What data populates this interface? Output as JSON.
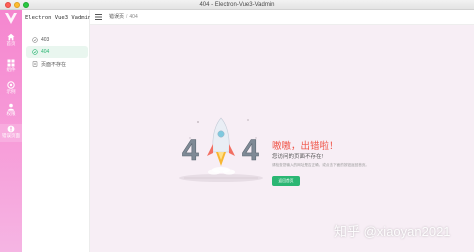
{
  "window": {
    "title": "404 - Electron-Vue3-Vadmin"
  },
  "rail": {
    "items": [
      {
        "label": "首页",
        "icon": "home-icon"
      },
      {
        "label": "组件",
        "icon": "grid-icon"
      },
      {
        "label": "示例",
        "icon": "sample-icon"
      },
      {
        "label": "权限",
        "icon": "user-icon"
      },
      {
        "label": "错误页面",
        "icon": "warning-icon",
        "active": true
      }
    ]
  },
  "menu": {
    "brand": "Electron Vue3 Vadmin",
    "items": [
      {
        "label": "403",
        "icon": "circle-icon"
      },
      {
        "label": "404",
        "icon": "circle-icon",
        "active": true
      },
      {
        "label": "页面不存在",
        "icon": "document-icon"
      }
    ]
  },
  "header": {
    "crumb_parent": "错误页",
    "crumb_sep": "/",
    "crumb_current": "404"
  },
  "error": {
    "title": "嗷嗷，出错啦！",
    "subtitle": "您访问的页面不存在!",
    "description": "请检查您输入的网址是否正确，或点击下面的按钮返回首页。",
    "button": "返回首页",
    "code": "404"
  },
  "watermark": "知乎 @xiaoyan2021",
  "colors": {
    "accent": "#2bb673",
    "error": "#f0564a",
    "rail": "#f586cf",
    "bg": "#f7eef5"
  }
}
